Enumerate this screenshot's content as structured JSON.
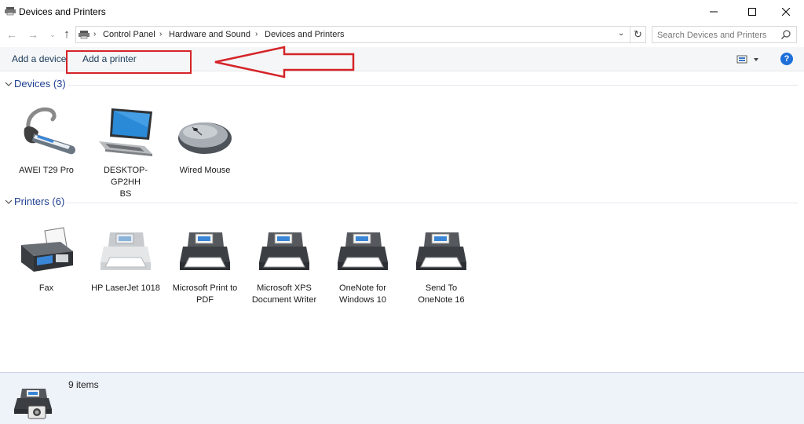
{
  "window": {
    "title": "Devices and Printers",
    "min_label": "—",
    "max_label": "☐",
    "close_label": "✕"
  },
  "address": {
    "back": "←",
    "forward": "→",
    "recent": "⌄",
    "up": "↑",
    "crumbs": [
      "Control Panel",
      "Hardware and Sound",
      "Devices and Printers"
    ],
    "sep": "›",
    "dropdown": "⌄",
    "refresh": "↻",
    "search_placeholder": "Search Devices and Printers"
  },
  "commands": {
    "add_device": "Add a device",
    "add_printer": "Add a printer",
    "help": "?"
  },
  "annotation": {
    "color": "#d42428"
  },
  "devices_group": {
    "title": "Devices (3)",
    "items": [
      {
        "label_lines": [
          "AWEI T29 Pro"
        ],
        "icon": "headset-icon"
      },
      {
        "label_lines": [
          "DESKTOP-GP2HH",
          "BS"
        ],
        "icon": "laptop-icon"
      },
      {
        "label_lines": [
          "Wired Mouse"
        ],
        "icon": "mouse-icon"
      }
    ]
  },
  "printers_group": {
    "title": "Printers (6)",
    "items": [
      {
        "label_lines": [
          "Fax"
        ],
        "icon": "fax-icon"
      },
      {
        "label_lines": [
          "HP LaserJet 1018"
        ],
        "icon": "printer-icon"
      },
      {
        "label_lines": [
          "Microsoft Print to",
          "PDF"
        ],
        "icon": "printer-icon"
      },
      {
        "label_lines": [
          "Microsoft XPS",
          "Document Writer"
        ],
        "icon": "printer-icon"
      },
      {
        "label_lines": [
          "OneNote for",
          "Windows 10"
        ],
        "icon": "printer-icon"
      },
      {
        "label_lines": [
          "Send To",
          "OneNote 16"
        ],
        "icon": "printer-icon"
      }
    ]
  },
  "details": {
    "count": "9 items"
  },
  "colors": {
    "accent": "#1e6fd9",
    "group_header": "#1e3f8f",
    "details_bg": "#eef2f9"
  }
}
